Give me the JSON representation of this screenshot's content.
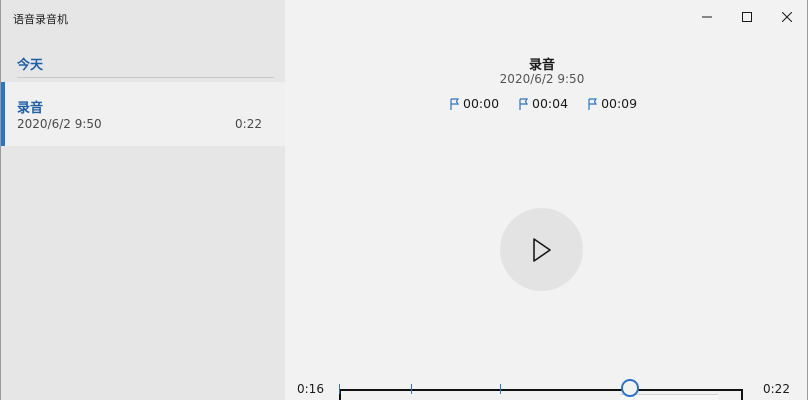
{
  "window": {
    "title": "语音录音机"
  },
  "sidebar": {
    "section_header": "今天",
    "recordings": [
      {
        "name": "录音",
        "date": "2020/6/2 9:50",
        "duration": "0:22"
      }
    ]
  },
  "main": {
    "title": "录音",
    "date": "2020/6/2 9:50",
    "markers": [
      "00:00",
      "00:04",
      "00:09"
    ],
    "play_icon": "play-icon",
    "timeline": {
      "current": "0:16",
      "total": "0:22",
      "progress": 0.727
    }
  },
  "colors": {
    "accent": "#2b74c6",
    "sidebar_bg": "#e6e6e6",
    "main_bg": "#f2f2f2"
  }
}
